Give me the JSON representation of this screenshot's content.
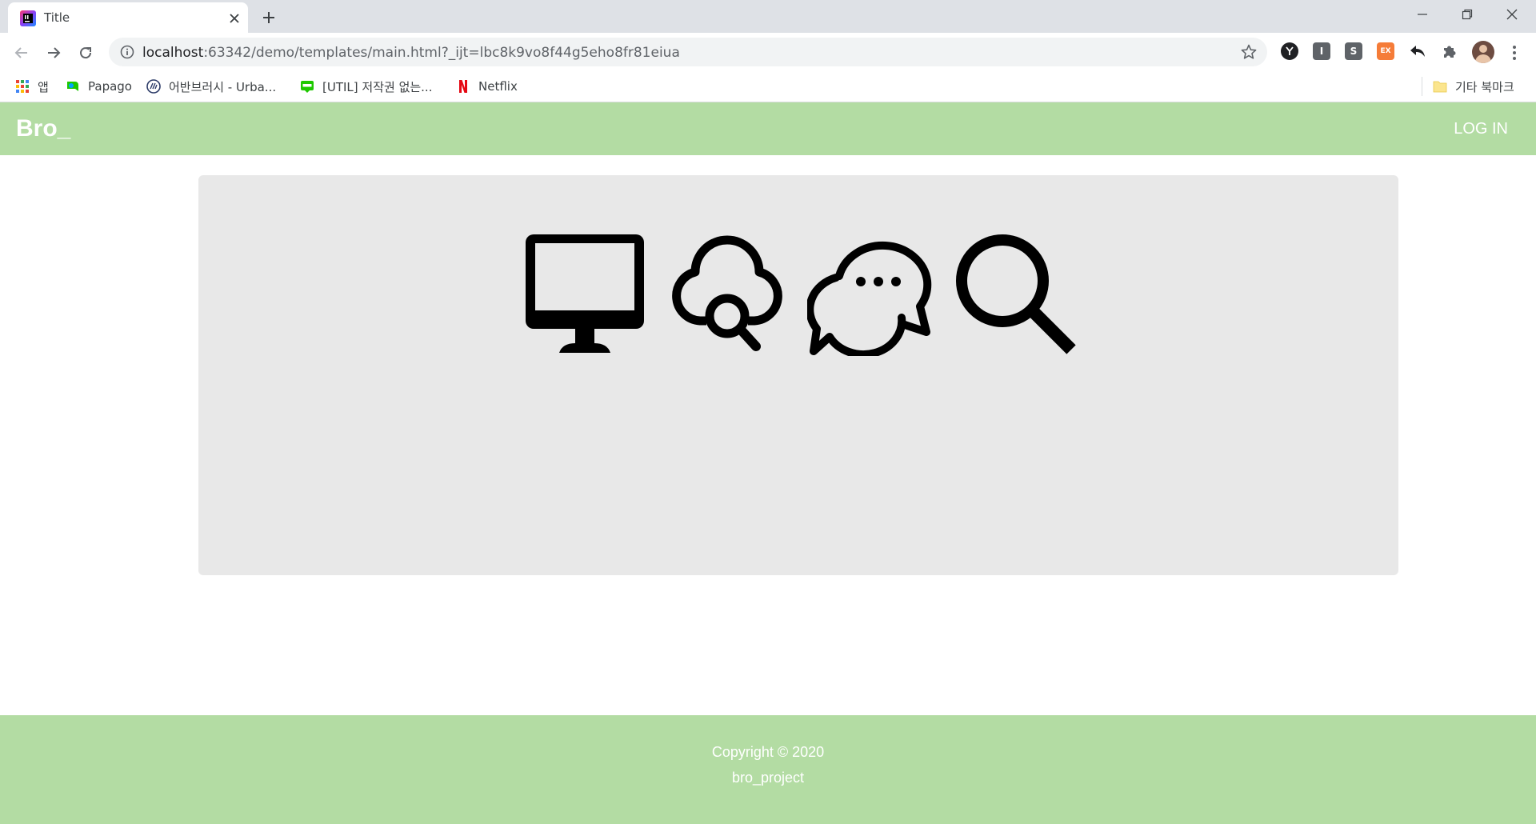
{
  "browser": {
    "tab_title": "Title",
    "url_host": "localhost",
    "url_rest": ":63342/demo/templates/main.html?_ijt=lbc8k9vo8f44g5eho8fr81eiua",
    "bookmarks": [
      {
        "label": "앱",
        "icon": "apps-grid-icon"
      },
      {
        "label": "Papago",
        "icon": "papago-icon"
      },
      {
        "label": "어반브러시 -  Urba...",
        "icon": "urbanbrush-icon"
      },
      {
        "label": "[UTIL] 저작권 없는...",
        "icon": "blog-icon"
      },
      {
        "label": "Netflix",
        "icon": "netflix-icon"
      }
    ],
    "other_bookmarks": "기타 북마크",
    "extensions": [
      {
        "label": "",
        "icon": "extension-y-icon",
        "color": "#202124"
      },
      {
        "label": "I",
        "icon": "extension-i-icon",
        "color": "#5f6368"
      },
      {
        "label": "S",
        "icon": "extension-s-icon",
        "color": "#5f6368"
      },
      {
        "label": "EX",
        "icon": "extension-ex-icon",
        "color": "#f57c38"
      }
    ]
  },
  "site": {
    "brand": "Bro_",
    "login_label": "LOG IN",
    "hero_icons": [
      "monitor-icon",
      "cloud-search-icon",
      "chat-bubbles-icon",
      "magnifier-icon"
    ],
    "footer": {
      "copyright": "Copyright © 2020",
      "project": "bro_project"
    }
  },
  "colors": {
    "header_bg": "#b3dca3",
    "hero_bg": "#e8e8e8",
    "footer_bg": "#b3dca3"
  }
}
